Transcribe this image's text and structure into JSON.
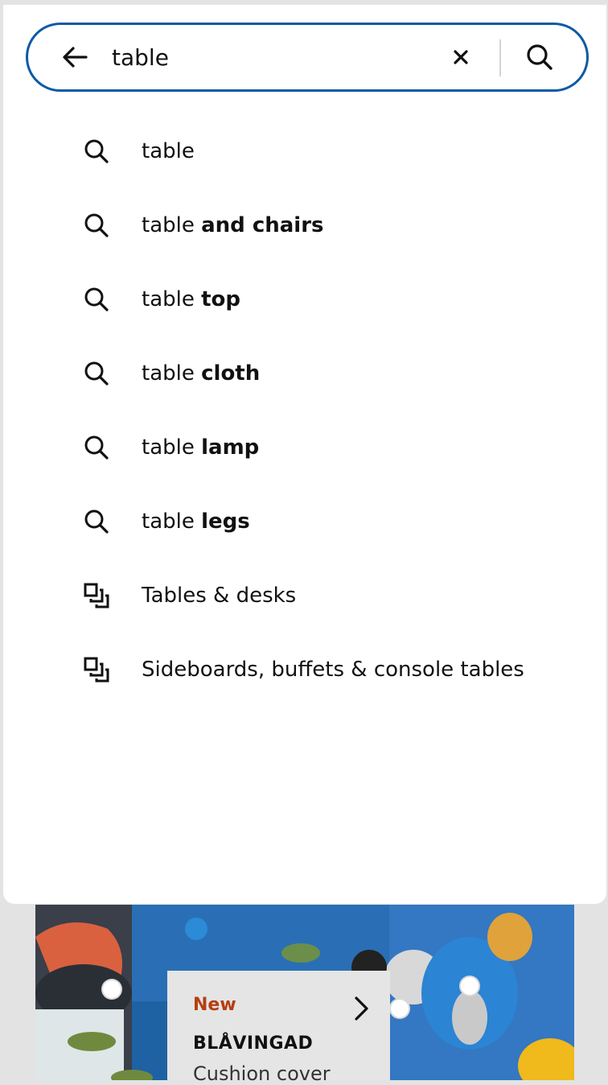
{
  "search": {
    "value": "table",
    "back_icon": "arrow-left-icon",
    "clear_icon": "close-icon",
    "submit_icon": "search-icon",
    "accent": "#0c5aa6"
  },
  "suggestions": [
    {
      "type": "query",
      "icon": "search-icon",
      "prefix": "table",
      "suffix": ""
    },
    {
      "type": "query",
      "icon": "search-icon",
      "prefix": "table",
      "suffix": "and chairs"
    },
    {
      "type": "query",
      "icon": "search-icon",
      "prefix": "table",
      "suffix": "top"
    },
    {
      "type": "query",
      "icon": "search-icon",
      "prefix": "table",
      "suffix": "cloth"
    },
    {
      "type": "query",
      "icon": "search-icon",
      "prefix": "table",
      "suffix": "lamp"
    },
    {
      "type": "query",
      "icon": "search-icon",
      "prefix": "table",
      "suffix": "legs"
    },
    {
      "type": "category",
      "icon": "category-icon",
      "label": "Tables & desks"
    },
    {
      "type": "category",
      "icon": "category-icon",
      "label": "Sideboards, buffets & console tables"
    }
  ],
  "promo": {
    "badge": "New",
    "product_name": "BLÅVINGAD",
    "product_desc": "Cushion cover",
    "badge_color": "#b43f13"
  }
}
